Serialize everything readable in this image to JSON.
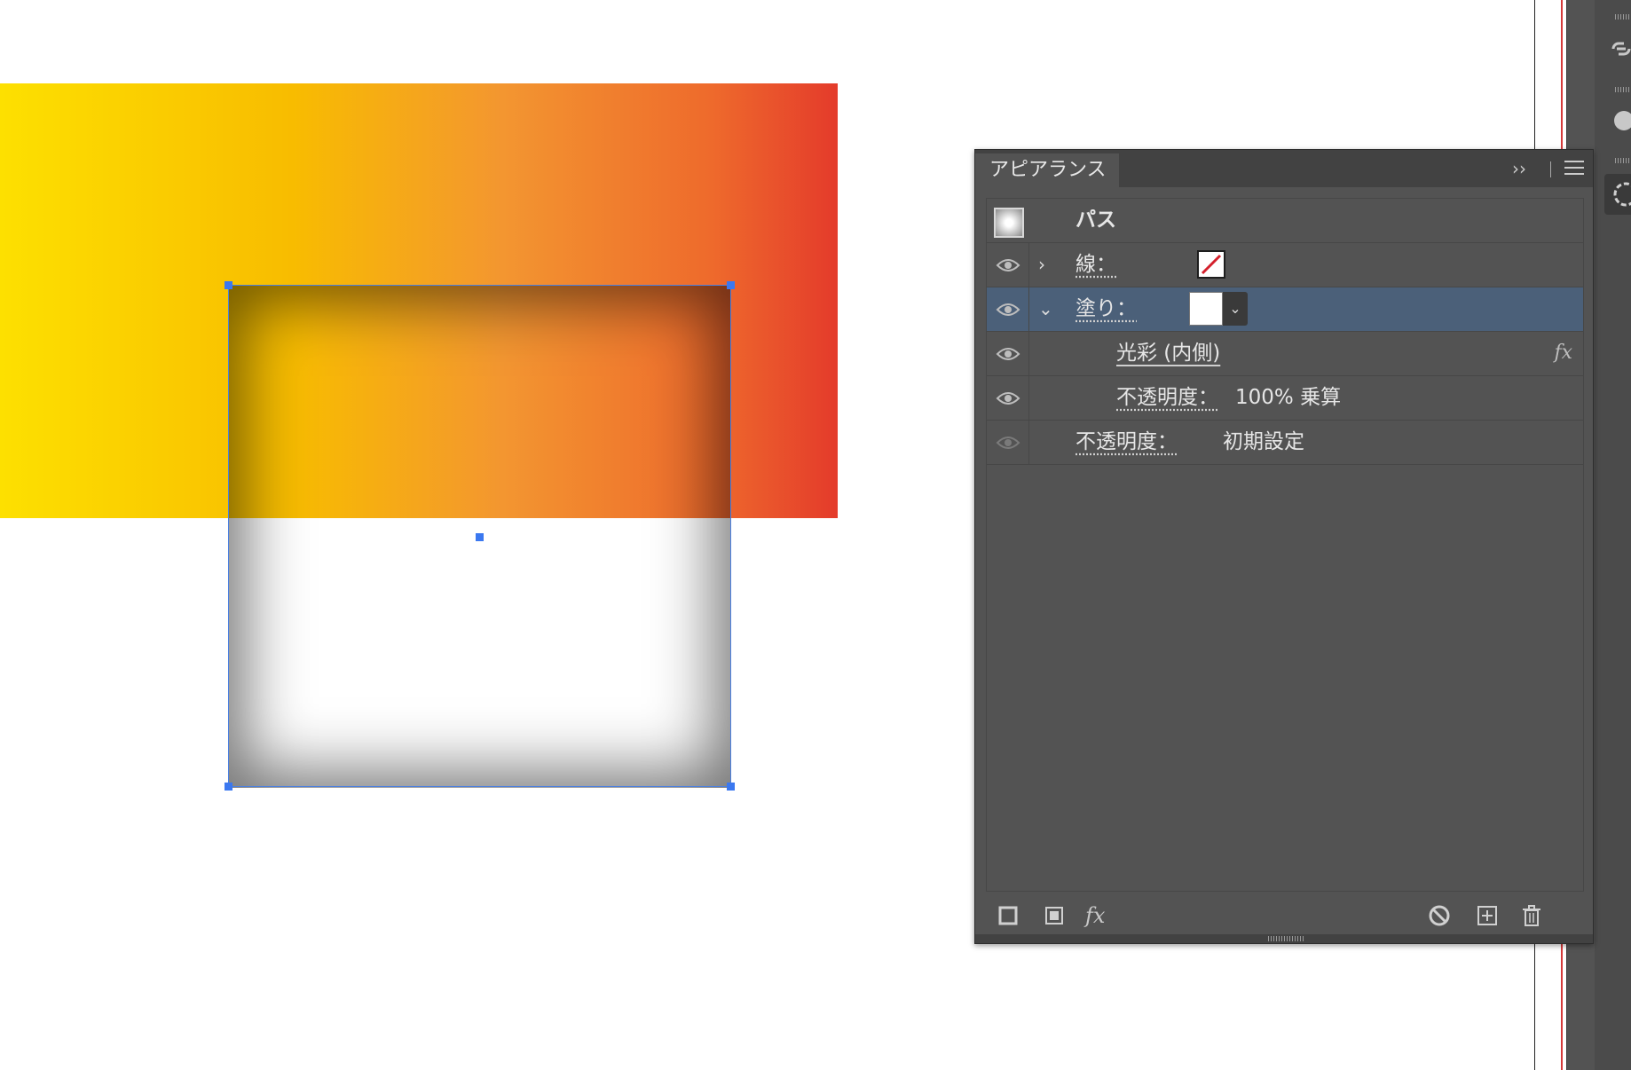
{
  "panel": {
    "tab_label": "アピアランス",
    "collapse_icon": "double-chevron-right-icon",
    "menu_icon": "hamburger-icon",
    "title_row": {
      "label": "パス"
    },
    "rows": [
      {
        "label": "線：",
        "expand": "›",
        "swatch": "stroke-none",
        "visible": true
      },
      {
        "label": "塗り：",
        "expand": "⌄",
        "swatch": "white",
        "selected": true,
        "visible": true
      },
      {
        "label": "光彩 (内側)",
        "fx": "fx",
        "indented": true,
        "visible": true
      },
      {
        "label": "不透明度：",
        "value": "100% 乗算",
        "indented": true,
        "visible": true
      },
      {
        "label": "不透明度：",
        "value": "初期設定",
        "visible": false
      }
    ],
    "footer": {
      "left": [
        "add-stroke-icon",
        "add-fill-icon",
        "fx-menu-icon"
      ],
      "right": [
        "clear-appearance-icon",
        "duplicate-item-icon",
        "trash-icon"
      ],
      "fx_label": "fx"
    }
  },
  "colors": {
    "selection": "#3b78f0",
    "panel_bg": "#535353",
    "selected_row": "#4b6079",
    "gradient_start": "#fde000",
    "gradient_end": "#e43b2b"
  }
}
